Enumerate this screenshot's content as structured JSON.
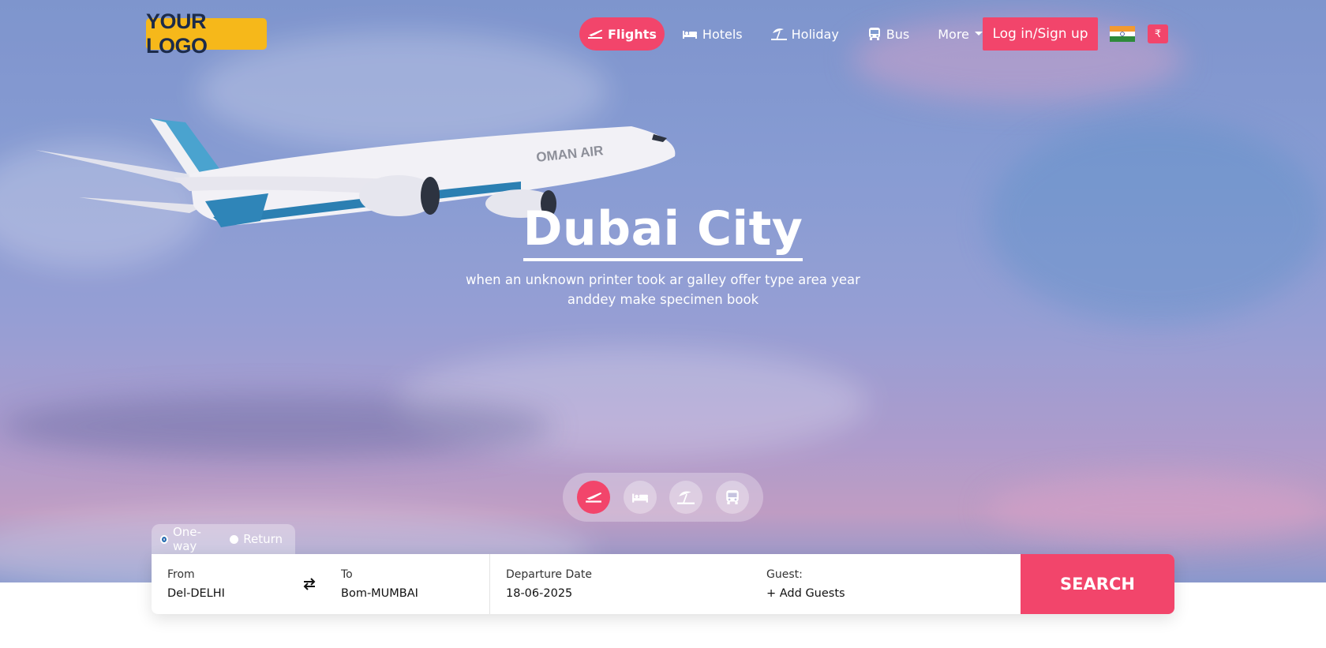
{
  "header": {
    "logo_text": "YOUR LOGO",
    "nav": [
      {
        "label": "Flights",
        "icon": "plane-icon",
        "active": true
      },
      {
        "label": "Hotels",
        "icon": "bed-icon"
      },
      {
        "label": "Holiday",
        "icon": "umbrella-beach-icon"
      },
      {
        "label": "Bus",
        "icon": "bus-icon"
      },
      {
        "label": "More",
        "icon": "chevron-down-icon"
      }
    ],
    "login_label": "Log in/Sign up",
    "currency_symbol": "₹"
  },
  "hero": {
    "title": "Dubai City",
    "subtitle": "when an unknown printer took ar galley offer type area year anddey make specimen book"
  },
  "search": {
    "trip_types": [
      "One-way",
      "Return"
    ],
    "selected_trip_type": "One-way",
    "from": {
      "label": "From",
      "value": "Del-DELHI"
    },
    "to": {
      "label": "To",
      "value": "Bom-MUMBAI"
    },
    "departure": {
      "label": "Departure Date",
      "value": "18-06-2025"
    },
    "guest": {
      "label": "Guest:",
      "value": "+ Add Guests"
    },
    "button_label": "SEARCH"
  },
  "colors": {
    "accent": "#f2456b",
    "logo_bg": "#f6b81a"
  }
}
